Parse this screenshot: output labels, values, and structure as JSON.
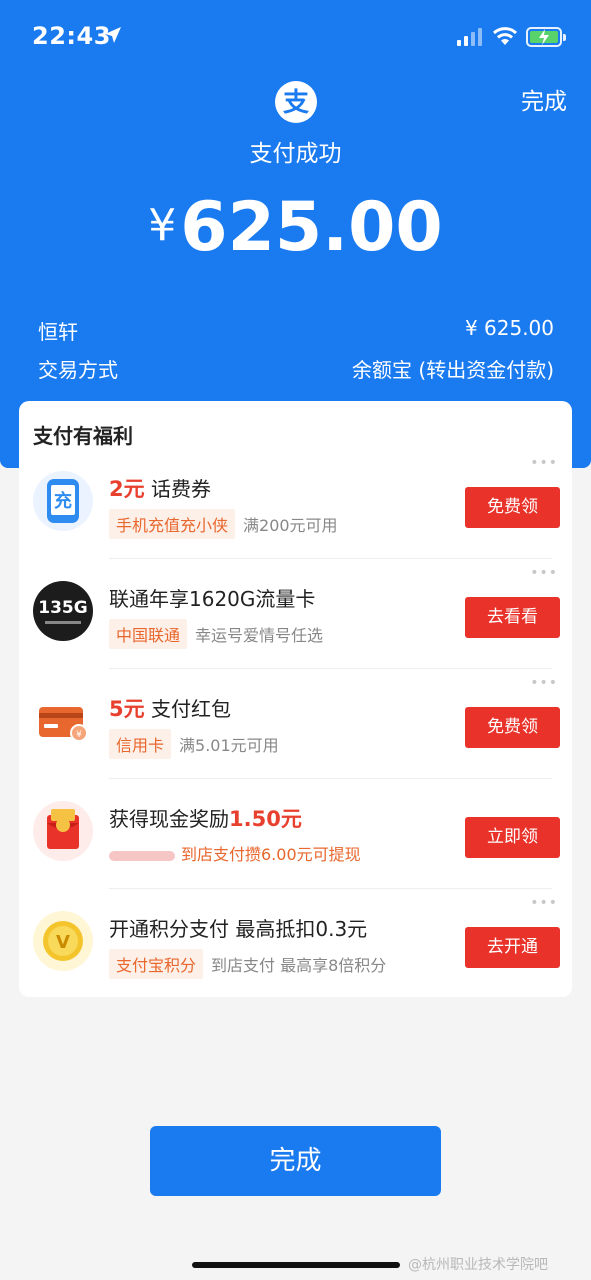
{
  "status_bar": {
    "time": "22:43"
  },
  "header": {
    "done_label": "完成",
    "title": "支付成功",
    "currency": "¥",
    "amount": "625.00"
  },
  "details": {
    "payee": "恒轩",
    "payee_amount": "¥ 625.00",
    "method_label": "交易方式",
    "method_value": "余额宝 (转出资金付款)"
  },
  "benefits": {
    "title": "支付有福利",
    "items": [
      {
        "title_prefix": "2元",
        "title": " 话费券",
        "tag": "手机充值充小侠",
        "sub": "满200元可用",
        "button": "免费领",
        "icon": "phone-recharge-icon"
      },
      {
        "title_prefix": "",
        "title": "联通年享1620G流量卡",
        "tag": "中国联通",
        "sub": "幸运号爱情号任选",
        "button": "去看看",
        "icon": "unicom-135g-icon",
        "icon_text": "135G"
      },
      {
        "title_prefix": "5元",
        "title": " 支付红包",
        "tag": "信用卡",
        "sub": "满5.01元可用",
        "button": "免费领",
        "icon": "credit-card-icon"
      },
      {
        "title_prefix": "",
        "title": "获得现金奖励",
        "title_suffix": "1.50元",
        "sub": "到店支付攒6.00元可提现",
        "button": "立即领",
        "icon": "red-envelope-icon"
      },
      {
        "title_prefix": "",
        "title": "开通积分支付 最高抵扣0.3元",
        "tag": "支付宝积分",
        "sub": "到店支付 最高享8倍积分",
        "button": "去开通",
        "icon": "points-medal-icon",
        "icon_text": "V"
      }
    ]
  },
  "footer": {
    "done_label": "完成",
    "watermark": "@杭州职业技术学院吧"
  },
  "colors": {
    "brand_blue": "#1a7aef",
    "button_red": "#e8322a",
    "tag_orange": "#e8672e"
  }
}
